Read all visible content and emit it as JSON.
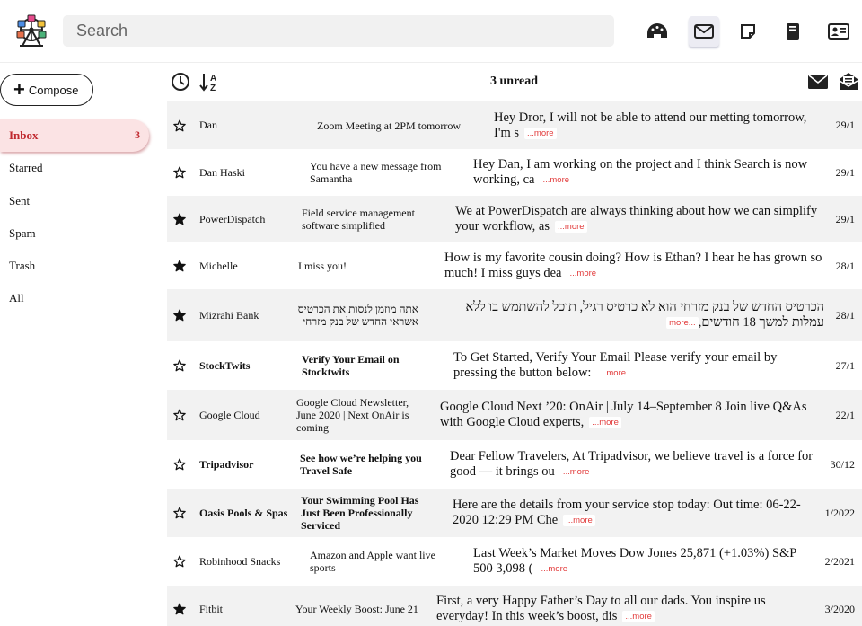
{
  "search": {
    "placeholder": "Search"
  },
  "header_icons": [
    "dashboard-icon",
    "mail-icon",
    "notes-icon",
    "book-icon",
    "contact-card-icon"
  ],
  "compose": {
    "label": "Compose"
  },
  "nav": [
    {
      "label": "Inbox",
      "count": "3"
    },
    {
      "label": "Starred"
    },
    {
      "label": "Sent"
    },
    {
      "label": "Spam"
    },
    {
      "label": "Trash"
    },
    {
      "label": "All"
    }
  ],
  "toolbar": {
    "unread": "3 unread"
  },
  "more_label": "...more",
  "emails": [
    {
      "starred": false,
      "unread": false,
      "sender": "Dan",
      "subject": "Zoom Meeting at 2PM tomorrow",
      "preview": "Hey Dror, I will not be able to attend our metting tomorrow, I'm s",
      "date": "29/1"
    },
    {
      "starred": false,
      "unread": false,
      "sender": "Dan Haski",
      "subject": "You have a new message from Samantha",
      "preview": "Hey Dan, I am working on the project and I think Search is now working, ca",
      "date": "29/1"
    },
    {
      "starred": true,
      "unread": false,
      "sender": "PowerDispatch",
      "subject": "Field service management software simplified",
      "preview": "We at PowerDispatch are always thinking about how we can simplify your workflow, as",
      "date": "29/1"
    },
    {
      "starred": true,
      "unread": false,
      "sender": "Michelle",
      "subject": "I miss you!",
      "preview": "How is my favorite cousin doing? How is Ethan? I hear he has grown so much! I miss guys dea",
      "date": "28/1"
    },
    {
      "starred": true,
      "unread": false,
      "sender": "Mizrahi Bank",
      "subject": "אתה מוזמן לנסות את הכרטיס אשראי החדש של בנק מזרחי",
      "preview": "הכרטיס החדש של בנק מזרחי הוא לא כרטיס רגיל, תוכל להשתמש בו ללא עמלות למשך 18 חודשים,",
      "date": "28/1",
      "rtl": true
    },
    {
      "starred": false,
      "unread": true,
      "sender": "StockTwits",
      "subject": "Verify Your Email on Stocktwits",
      "preview": "To Get Started, Verify Your Email Please verify your email by pressing the button below:",
      "date": "27/1"
    },
    {
      "starred": false,
      "unread": false,
      "sender": "Google Cloud",
      "subject": "Google Cloud Newsletter, June 2020 | Next OnAir is coming",
      "preview": "Google Cloud Next ’20: OnAir | July 14–September 8 Join live Q&As with Google Cloud experts,",
      "date": "22/1"
    },
    {
      "starred": false,
      "unread": true,
      "sender": "Tripadvisor",
      "subject": "See how we’re helping you Travel Safe",
      "preview": "Dear Fellow Travelers, At Tripadvisor, we believe travel is a force for good — it brings ou",
      "date": "30/12"
    },
    {
      "starred": false,
      "unread": true,
      "sender": "Oasis Pools & Spas",
      "subject": "Your Swimming Pool Has Just Been Professionally Serviced",
      "preview": "Here are the details from your service stop today: Out time: 06-22-2020 12:29 PM Che",
      "date": "1/2022"
    },
    {
      "starred": false,
      "unread": false,
      "sender": "Robinhood Snacks",
      "subject": "Amazon and Apple want live sports",
      "preview": "Last Week’s Market Moves Dow Jones 25,871 (+1.03%) S&P 500 3,098 (",
      "date": "2/2021"
    },
    {
      "starred": true,
      "unread": false,
      "sender": "Fitbit",
      "subject": "Your Weekly Boost: June 21",
      "preview": "First, a very Happy Father’s Day to all our dads. You inspire us everyday! In this week’s boost, dis",
      "date": "3/2020"
    }
  ]
}
